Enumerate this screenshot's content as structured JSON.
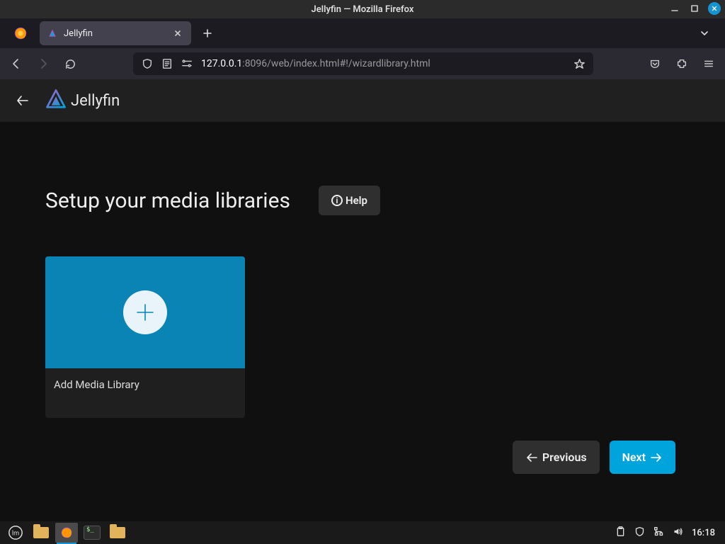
{
  "window": {
    "title": "Jellyfin — Mozilla Firefox"
  },
  "browser": {
    "tab_title": "Jellyfin",
    "url": {
      "host": "127.0.0.1",
      "path": ":8096/web/index.html#!/wizardlibrary.html"
    }
  },
  "app": {
    "brand": "Jellyfin",
    "page_title": "Setup your media libraries",
    "help_label": "Help",
    "add_library_label": "Add Media Library",
    "prev_label": "Previous",
    "next_label": "Next"
  },
  "taskbar": {
    "clock": "16:18"
  },
  "colors": {
    "accent": "#00a4dc",
    "card_blue": "#0a84b5"
  }
}
